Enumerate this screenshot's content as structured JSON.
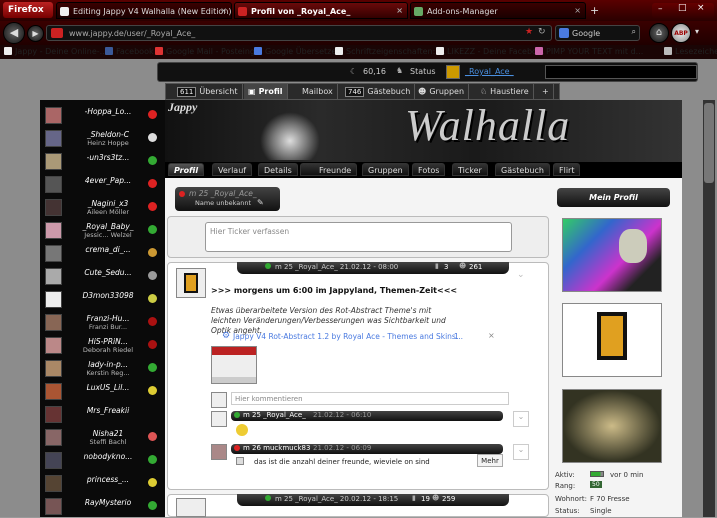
{
  "browser": {
    "menu_label": "Firefox",
    "tabs": [
      {
        "label": "Editing Jappy V4 Walhalla (New Edition)..."
      },
      {
        "label": "Profil von _Royal_Ace_"
      },
      {
        "label": "Add-ons-Manager"
      }
    ],
    "url": "www.jappy.de/user/_Royal_Ace_",
    "search_value": "Google",
    "bookmarks": [
      "Jappy - Deine Online-...",
      "Facebook",
      "Google Mail - Posteing...",
      "Google Übersetzer",
      "Schriftzeigenschaften: ...",
      "LIKEZZ - Deine Facebo...",
      "PIMP YOUR TEXT mit d..."
    ],
    "bookmarks_more": "Lesezeichen",
    "addon_badge": "ABP"
  },
  "topbar": {
    "points": "60,16",
    "status_label": "Status",
    "username": "_Royal_Ace_"
  },
  "mainnav": {
    "items": [
      {
        "badge": "611",
        "label": "Übersicht"
      },
      {
        "badge": "",
        "label": "Profil"
      },
      {
        "badge": "",
        "label": "Mailbox"
      },
      {
        "badge": "746",
        "label": "Gästebuch"
      },
      {
        "badge": "",
        "label": "Gruppen"
      },
      {
        "badge": "",
        "label": "Haustiere"
      },
      {
        "badge": "",
        "label": "+"
      }
    ]
  },
  "friends": [
    {
      "name": "-Hoppa_Lo...",
      "sub": ""
    },
    {
      "name": "_Sheldon-C",
      "sub": "Heinz Hoppe"
    },
    {
      "name": "-un3rs3tz...",
      "sub": ""
    },
    {
      "name": "4ever_Pap...",
      "sub": ""
    },
    {
      "name": "_Nagini_x3",
      "sub": "Aileen Möller"
    },
    {
      "name": "_Royal_Baby_",
      "sub": "Jessic... Welzel"
    },
    {
      "name": "crema_di_...",
      "sub": ""
    },
    {
      "name": "Cute_Sedu...",
      "sub": ""
    },
    {
      "name": "D3mon33098",
      "sub": ""
    },
    {
      "name": "Franzi-Hu...",
      "sub": "Franzi Bur..."
    },
    {
      "name": "HiS-PRiN...",
      "sub": "Deborah Riedel"
    },
    {
      "name": "lady-in-p...",
      "sub": "Kerstin Reg..."
    },
    {
      "name": "LuxUS_Lil...",
      "sub": ""
    },
    {
      "name": "Mrs_Freakii",
      "sub": ""
    },
    {
      "name": "Nisha21",
      "sub": "Steffi Bachl"
    },
    {
      "name": "nobodykno...",
      "sub": ""
    },
    {
      "name": "princess_...",
      "sub": ""
    },
    {
      "name": "RayMysterio",
      "sub": ""
    }
  ],
  "banner": {
    "logo": "Jappy",
    "title": "Walhalla"
  },
  "subnav": [
    "Profil",
    "Verlauf",
    "Details",
    "Freunde",
    "Gruppen",
    "Fotos",
    "Ticker",
    "Gästebuch",
    "Flirt"
  ],
  "profile": {
    "name_line": "m 25 _Royal_Ace_",
    "realname": "Name unbekannt",
    "ticker_placeholder": "Hier Ticker verfassen",
    "mein_profil": "Mein Profil"
  },
  "post": {
    "header": "m 25 _Royal_Ace_ 21.02.12 - 08:00",
    "comments_count": "3",
    "views_count": "261",
    "title": ">>> morgens um 6:00 im Jappyland, Themen-Zeit<<<",
    "body": "Etwas überarbeitete Version des Rot-Abstract Theme's mit leichten Veränderungen/Verbesserungen was Sichtbarkeit und Optik angeht.",
    "link_title": "Jappy V4 Rot-Abstract 1.2 by Royal Ace - Themes and Skins...",
    "link_count": "1",
    "comment_placeholder": "Hier kommentieren",
    "comments": [
      {
        "author": "m 25 _Royal_Ace_",
        "date": "21.02.12 - 06:10",
        "text": ""
      },
      {
        "author": "m 26 muckmuck83",
        "date": "21.02.12 - 06:09",
        "text": "das ist die anzahl deiner freunde, wieviele on sind",
        "more": "Mehr"
      }
    ]
  },
  "post2": {
    "header": "m 25 _Royal_Ace_ 20.02.12 - 18:15",
    "comments_count": "19",
    "views_count": "259"
  },
  "stats": {
    "aktiv_label": "Aktiv:",
    "aktiv_value": "vor 0 min",
    "rang_label": "Rang:",
    "rang_value": "50",
    "wohnort_label": "Wohnort:",
    "wohnort_value": "F 70 Fresse",
    "status_label": "Status:",
    "status_value": "Single"
  },
  "colors": {
    "brand_red": "#7a0000",
    "online": "#3a3",
    "heart": "#d22"
  }
}
